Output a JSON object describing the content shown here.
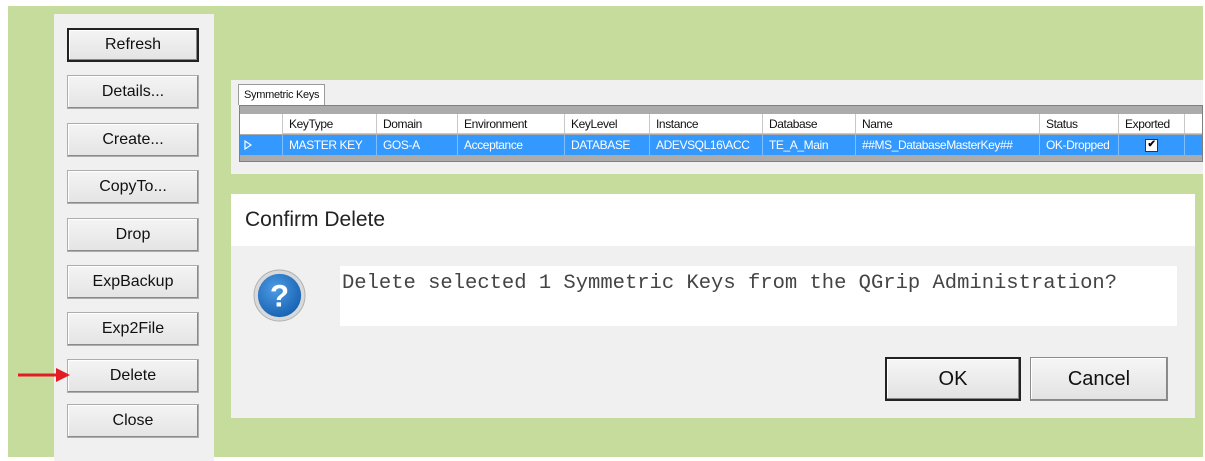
{
  "sidebar": {
    "buttons": [
      "Refresh",
      "Details...",
      "Create...",
      "CopyTo...",
      "Drop",
      "ExpBackup",
      "Exp2File",
      "Delete",
      "Close"
    ]
  },
  "grid": {
    "tab_label": "Symmetric Keys",
    "columns": [
      "KeyType",
      "Domain",
      "Environment",
      "KeyLevel",
      "Instance",
      "Database",
      "Name",
      "Status",
      "Exported"
    ],
    "rows": [
      {
        "KeyType": "MASTER KEY",
        "Domain": "GOS-A",
        "Environment": "Acceptance",
        "KeyLevel": "DATABASE",
        "Instance": "ADEVSQL16\\ACC",
        "Database": "TE_A_Main",
        "Name": "##MS_DatabaseMasterKey##",
        "Status": "OK-Dropped",
        "Exported": true
      }
    ]
  },
  "dialog": {
    "title": "Confirm Delete",
    "message": "Delete selected 1 Symmetric Keys from the QGrip Administration?",
    "ok_label": "OK",
    "cancel_label": "Cancel",
    "icon": "question-icon"
  },
  "colors": {
    "background": "#c5dc9c",
    "selection": "#3399ff",
    "arrow": "#e31b23",
    "icon_blue": "#1a65b4"
  }
}
